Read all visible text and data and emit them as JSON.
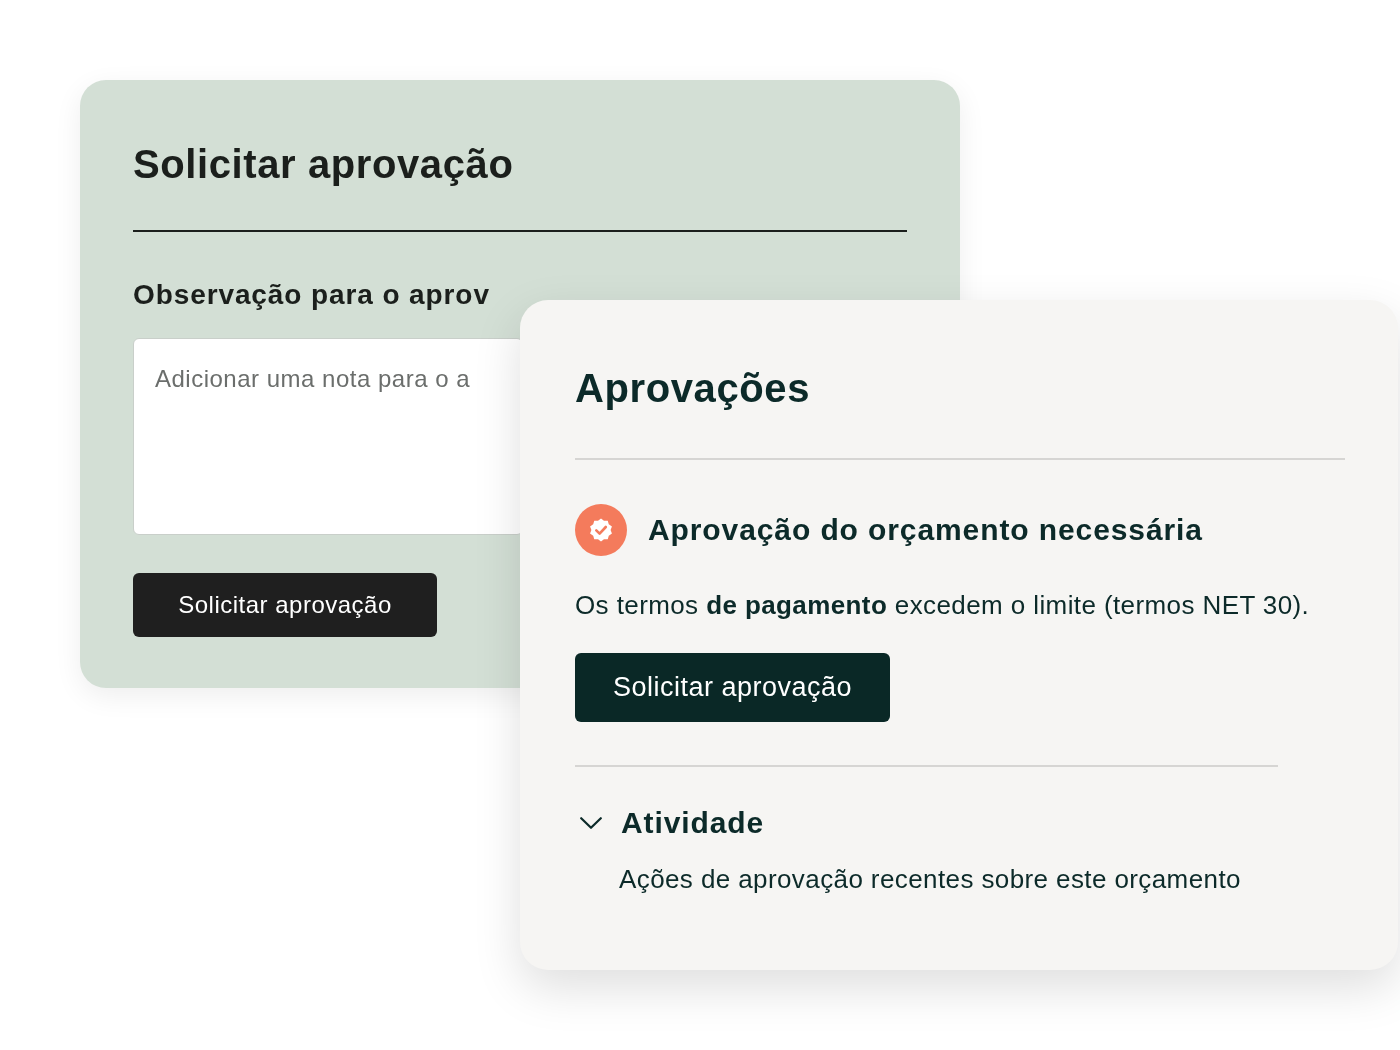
{
  "request_panel": {
    "title": "Solicitar aprovação",
    "note_label": "Observação para o aprov",
    "note_field": {
      "placeholder": "Adicionar uma nota para o a"
    },
    "submit_button": "Solicitar aprovação"
  },
  "approvals_panel": {
    "title": "Aprovações",
    "alert": {
      "heading": "Aprovação do orçamento necessária",
      "description": "Os termos **de pagamento** excedem o limite (termos NET 30)."
    },
    "request_button": "Solicitar aprovação",
    "activity": {
      "title": "Atividade",
      "expanded": true,
      "description": "Ações de aprovação recentes sobre este orçamento"
    }
  }
}
